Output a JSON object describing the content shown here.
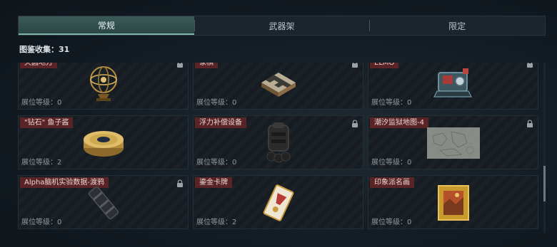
{
  "tabs": [
    {
      "label": "常规",
      "active": true
    },
    {
      "label": "武器架",
      "active": false
    },
    {
      "label": "限定",
      "active": false
    }
  ],
  "collection": {
    "text": "图鉴收集：31"
  },
  "items": [
    {
      "name": "天圆地方",
      "level": "展位等级：0",
      "locked": true,
      "icon": "armillary-sphere-icon"
    },
    {
      "name": "象棋",
      "level": "展位等级：0",
      "locked": true,
      "icon": "chess-board-icon"
    },
    {
      "name": "ELMO",
      "level": "展位等级：0",
      "locked": true,
      "icon": "elmo-device-icon"
    },
    {
      "name": "\"钻石\" 鱼子酱",
      "level": "展位等级：2",
      "locked": false,
      "icon": "caviar-tin-icon"
    },
    {
      "name": "浮力补偿设备",
      "level": "展位等级：0",
      "locked": true,
      "icon": "buoyancy-vest-icon"
    },
    {
      "name": "潮汐监狱地图-4",
      "level": "展位等级：0",
      "locked": true,
      "icon": "map-sheet-icon"
    },
    {
      "name": "Alpha脑机实验数据-渡鸦",
      "level": "展位等级：0",
      "locked": true,
      "icon": "data-cylinder-icon"
    },
    {
      "name": "鎏金卡牌",
      "level": "展位等级：2",
      "locked": false,
      "icon": "gilded-card-icon"
    },
    {
      "name": "印象派名画",
      "level": "展位等级：0",
      "locked": false,
      "icon": "framed-painting-icon"
    }
  ],
  "colors": {
    "accent": "#7fb3ad",
    "name_badge": "#5a2326",
    "background": "#131c23"
  }
}
